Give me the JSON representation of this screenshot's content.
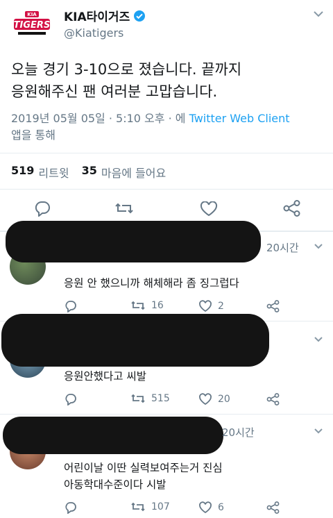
{
  "tweet": {
    "name": "KIA타이거즈",
    "handle": "@Kiatigers",
    "avatar_text": "TIGERS",
    "avatar_small": "KIA",
    "text_line1": "오늘 경기 3-10으로 졌습니다.  끝까지",
    "text_line2": "응원해주신 팬 여러분 고맙습니다.",
    "meta_time": "2019년 05월 05일 · 5:10 오후 · 에",
    "meta_source": "Twitter Web Client",
    "meta_suffix": "앱을 통해",
    "retweet_count": "519",
    "retweet_label": "리트윗",
    "like_count": "35",
    "like_label": "마음에 들어요"
  },
  "replies": [
    {
      "time": "20시간",
      "text": "응원 안 했으니까 해체해라 좀 징그럽다",
      "retweets": "16",
      "likes": "2"
    },
    {
      "time": "",
      "text": "응원안했다고 씨발",
      "retweets": "515",
      "likes": "20"
    },
    {
      "time": "20시간",
      "text_line1": "어린이날 이딴 실력보여주는거 진심",
      "text_line2": "아동학대수준이다 시발",
      "retweets": "107",
      "likes": "6"
    }
  ],
  "colors": {
    "link": "#1da1f2",
    "muted": "#657786",
    "brand_red": "#d31145",
    "verified": "#1da1f2"
  }
}
